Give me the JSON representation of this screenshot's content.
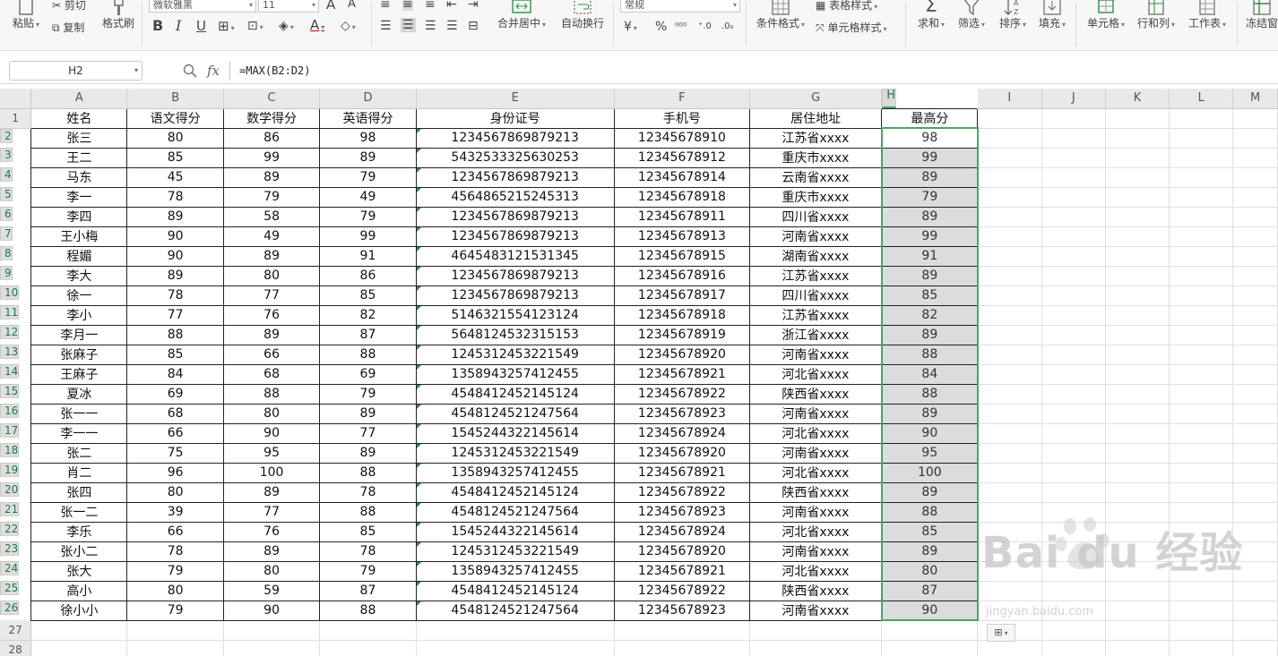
{
  "ribbon": {
    "cut": "剪切",
    "paste": "粘贴",
    "copy": "复制",
    "format_painter": "格式刷",
    "font_name": "微软雅黑",
    "font_size": "11",
    "merge_center": "合并居中",
    "wrap_text": "自动换行",
    "number_format": "常规",
    "conditional_format": "条件格式",
    "table_style": "表格样式",
    "cell_style": "单元格样式",
    "sum": "求和",
    "filter": "筛选",
    "sort": "排序",
    "fill": "填充",
    "cell": "单元格",
    "row_col": "行和列",
    "worksheet": "工作表",
    "freeze": "冻结窗"
  },
  "formula_bar": {
    "name_box": "H2",
    "fx": "fx",
    "formula": "=MAX(B2:D2)"
  },
  "columns": [
    "A",
    "B",
    "C",
    "D",
    "E",
    "F",
    "G",
    "H",
    "I",
    "J",
    "K",
    "L",
    "M"
  ],
  "headers": [
    "姓名",
    "语文得分",
    "数学得分",
    "英语得分",
    "身份证号",
    "手机号",
    "居住地址",
    "最高分"
  ],
  "rows": [
    [
      "张三",
      "80",
      "86",
      "98",
      "1234567869879213",
      "12345678910",
      "江苏省xxxx",
      "98"
    ],
    [
      "王二",
      "85",
      "99",
      "89",
      "5432533325630253",
      "12345678912",
      "重庆市xxxx",
      "99"
    ],
    [
      "马东",
      "45",
      "89",
      "79",
      "1234567869879213",
      "12345678914",
      "云南省xxxx",
      "89"
    ],
    [
      "李一",
      "78",
      "79",
      "49",
      "4564865215245313",
      "12345678918",
      "重庆市xxxx",
      "79"
    ],
    [
      "李四",
      "89",
      "58",
      "79",
      "1234567869879213",
      "12345678911",
      "四川省xxxx",
      "89"
    ],
    [
      "王小梅",
      "90",
      "49",
      "99",
      "1234567869879213",
      "12345678913",
      "河南省xxxx",
      "99"
    ],
    [
      "程媚",
      "90",
      "89",
      "91",
      "4645483121531345",
      "12345678915",
      "湖南省xxxx",
      "91"
    ],
    [
      "李大",
      "89",
      "80",
      "86",
      "1234567869879213",
      "12345678916",
      "江苏省xxxx",
      "89"
    ],
    [
      "徐一",
      "78",
      "77",
      "85",
      "1234567869879213",
      "12345678917",
      "四川省xxxx",
      "85"
    ],
    [
      "李小",
      "77",
      "76",
      "82",
      "5146321554123124",
      "12345678918",
      "江苏省xxxx",
      "82"
    ],
    [
      "李月一",
      "88",
      "89",
      "87",
      "5648124532315153",
      "12345678919",
      "浙江省xxxx",
      "89"
    ],
    [
      "张麻子",
      "85",
      "66",
      "88",
      "1245312453221549",
      "12345678920",
      "河南省xxxx",
      "88"
    ],
    [
      "王麻子",
      "84",
      "68",
      "69",
      "1358943257412455",
      "12345678921",
      "河北省xxxx",
      "84"
    ],
    [
      "夏冰",
      "69",
      "88",
      "79",
      "4548412452145124",
      "12345678922",
      "陕西省xxxx",
      "88"
    ],
    [
      "张一一",
      "68",
      "80",
      "89",
      "4548124521247564",
      "12345678923",
      "河南省xxxx",
      "89"
    ],
    [
      "李一一",
      "66",
      "90",
      "77",
      "1545244322145614",
      "12345678924",
      "河北省xxxx",
      "90"
    ],
    [
      "张二",
      "75",
      "95",
      "89",
      "1245312453221549",
      "12345678920",
      "河南省xxxx",
      "95"
    ],
    [
      "肖二",
      "96",
      "100",
      "88",
      "1358943257412455",
      "12345678921",
      "河北省xxxx",
      "100"
    ],
    [
      "张四",
      "80",
      "89",
      "78",
      "4548412452145124",
      "12345678922",
      "陕西省xxxx",
      "89"
    ],
    [
      "张一二",
      "39",
      "77",
      "88",
      "4548124521247564",
      "12345678923",
      "河南省xxxx",
      "88"
    ],
    [
      "李乐",
      "66",
      "76",
      "85",
      "1545244322145614",
      "12345678924",
      "河北省xxxx",
      "85"
    ],
    [
      "张小二",
      "78",
      "89",
      "78",
      "1245312453221549",
      "12345678920",
      "河南省xxxx",
      "89"
    ],
    [
      "张大",
      "79",
      "80",
      "79",
      "1358943257412455",
      "12345678921",
      "河北省xxxx",
      "80"
    ],
    [
      "高小",
      "80",
      "59",
      "87",
      "4548412452145124",
      "12345678922",
      "陕西省xxxx",
      "87"
    ],
    [
      "徐小小",
      "79",
      "90",
      "88",
      "4548124521247564",
      "12345678923",
      "河南省xxxx",
      "90"
    ]
  ],
  "watermark": {
    "brand": "Bai  du 经验",
    "url": "jingyan.baidu.com"
  },
  "colors": {
    "selection": "#4aa564",
    "header_bg": "#e9e9e9",
    "selected_fill": "#dcdcdc"
  }
}
